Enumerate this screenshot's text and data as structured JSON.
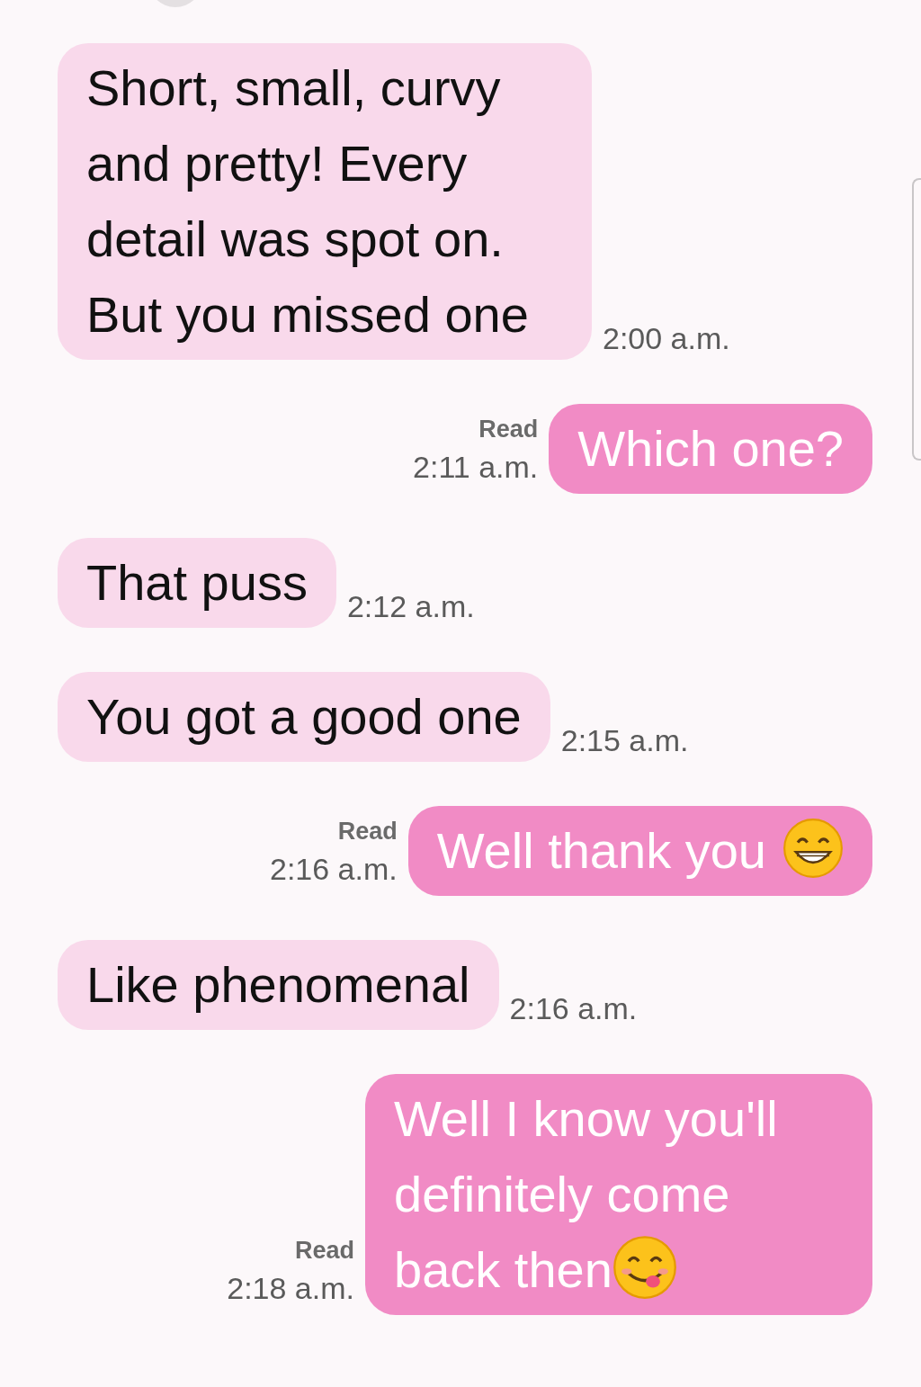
{
  "messages": [
    {
      "kind": "incoming",
      "text": "Short, small, curvy and pretty! Every detail was spot on. But you missed one",
      "time": "2:00 a.m."
    },
    {
      "kind": "outgoing",
      "text": "Which one?",
      "time": "2:11 a.m.",
      "status": "Read"
    },
    {
      "kind": "incoming",
      "text": "That puss",
      "time": "2:12 a.m."
    },
    {
      "kind": "incoming",
      "text": "You got a good one",
      "time": "2:15 a.m."
    },
    {
      "kind": "outgoing",
      "text": "Well thank you",
      "emoji": {
        "kind": "grin"
      },
      "time": "2:16 a.m.",
      "status": "Read"
    },
    {
      "kind": "incoming",
      "text": "Like phenomenal",
      "time": "2:16 a.m."
    },
    {
      "kind": "outgoing",
      "text": "Well I know you'll definitely come back then",
      "emoji": {
        "kind": "yum"
      },
      "time": "2:18 a.m.",
      "status": "Read"
    }
  ]
}
